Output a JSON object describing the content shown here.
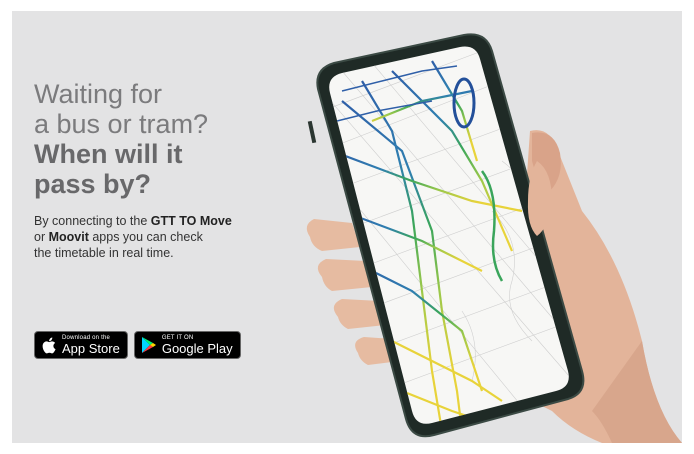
{
  "headline": {
    "line1": "Waiting for",
    "line2": "a bus or tram?",
    "line3": "When will it",
    "line4": "pass by?"
  },
  "description": {
    "part1": "By connecting to the ",
    "app1": "GTT TO Move",
    "part2": "or ",
    "app2": "Moovit",
    "part3": " apps you can check",
    "part4": "the timetable in real time."
  },
  "badges": {
    "appstore": {
      "small": "Download on the",
      "big": "App Store",
      "icon": "apple-icon"
    },
    "googleplay": {
      "small": "GET IT ON",
      "big": "Google Play",
      "icon": "google-play-icon"
    }
  },
  "colors": {
    "background": "#e3e3e4",
    "headline": "#7b7b7d",
    "badge": "#000000",
    "map_blue": "#2f5fa8",
    "map_green": "#3aa55b",
    "map_yellow": "#e8d33a"
  }
}
